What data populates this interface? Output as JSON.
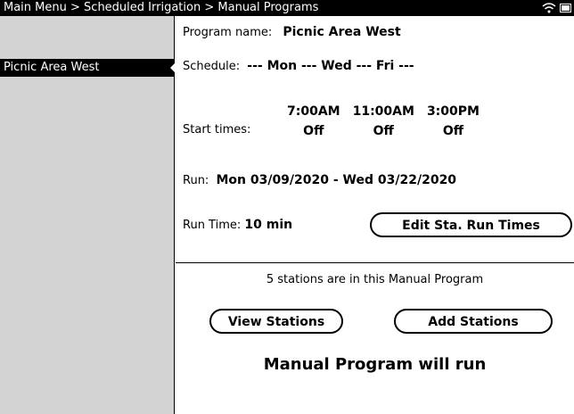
{
  "breadcrumb": {
    "main_menu": "Main Menu",
    "sep1": ">",
    "scheduled_irrigation": "Scheduled Irrigation",
    "sep2": ">",
    "manual_programs": "Manual Programs"
  },
  "status_icons": [
    "wifi-icon",
    "battery-icon"
  ],
  "sidebar": {
    "items": [
      {
        "label": "Picnic Area West",
        "selected": true
      }
    ]
  },
  "program": {
    "name_label": "Program name:",
    "name_value": "Picnic Area West",
    "schedule_label": "Schedule:",
    "schedule_value": "--- Mon --- Wed --- Fri ---",
    "start_times_label": "Start times:",
    "start_times": [
      {
        "time": "7:00AM",
        "state": "Off"
      },
      {
        "time": "11:00AM",
        "state": "Off"
      },
      {
        "time": "3:00PM",
        "state": "Off"
      }
    ],
    "run_label": "Run:",
    "run_value": "Mon 03/09/2020 - Wed 03/22/2020",
    "run_time_label": "Run Time:",
    "run_time_value": "10 min",
    "edit_button": "Edit Sta. Run Times"
  },
  "stations": {
    "info": "5 stations are in this Manual Program",
    "view_button": "View Stations",
    "add_button": "Add Stations",
    "status": "Manual Program will run"
  }
}
